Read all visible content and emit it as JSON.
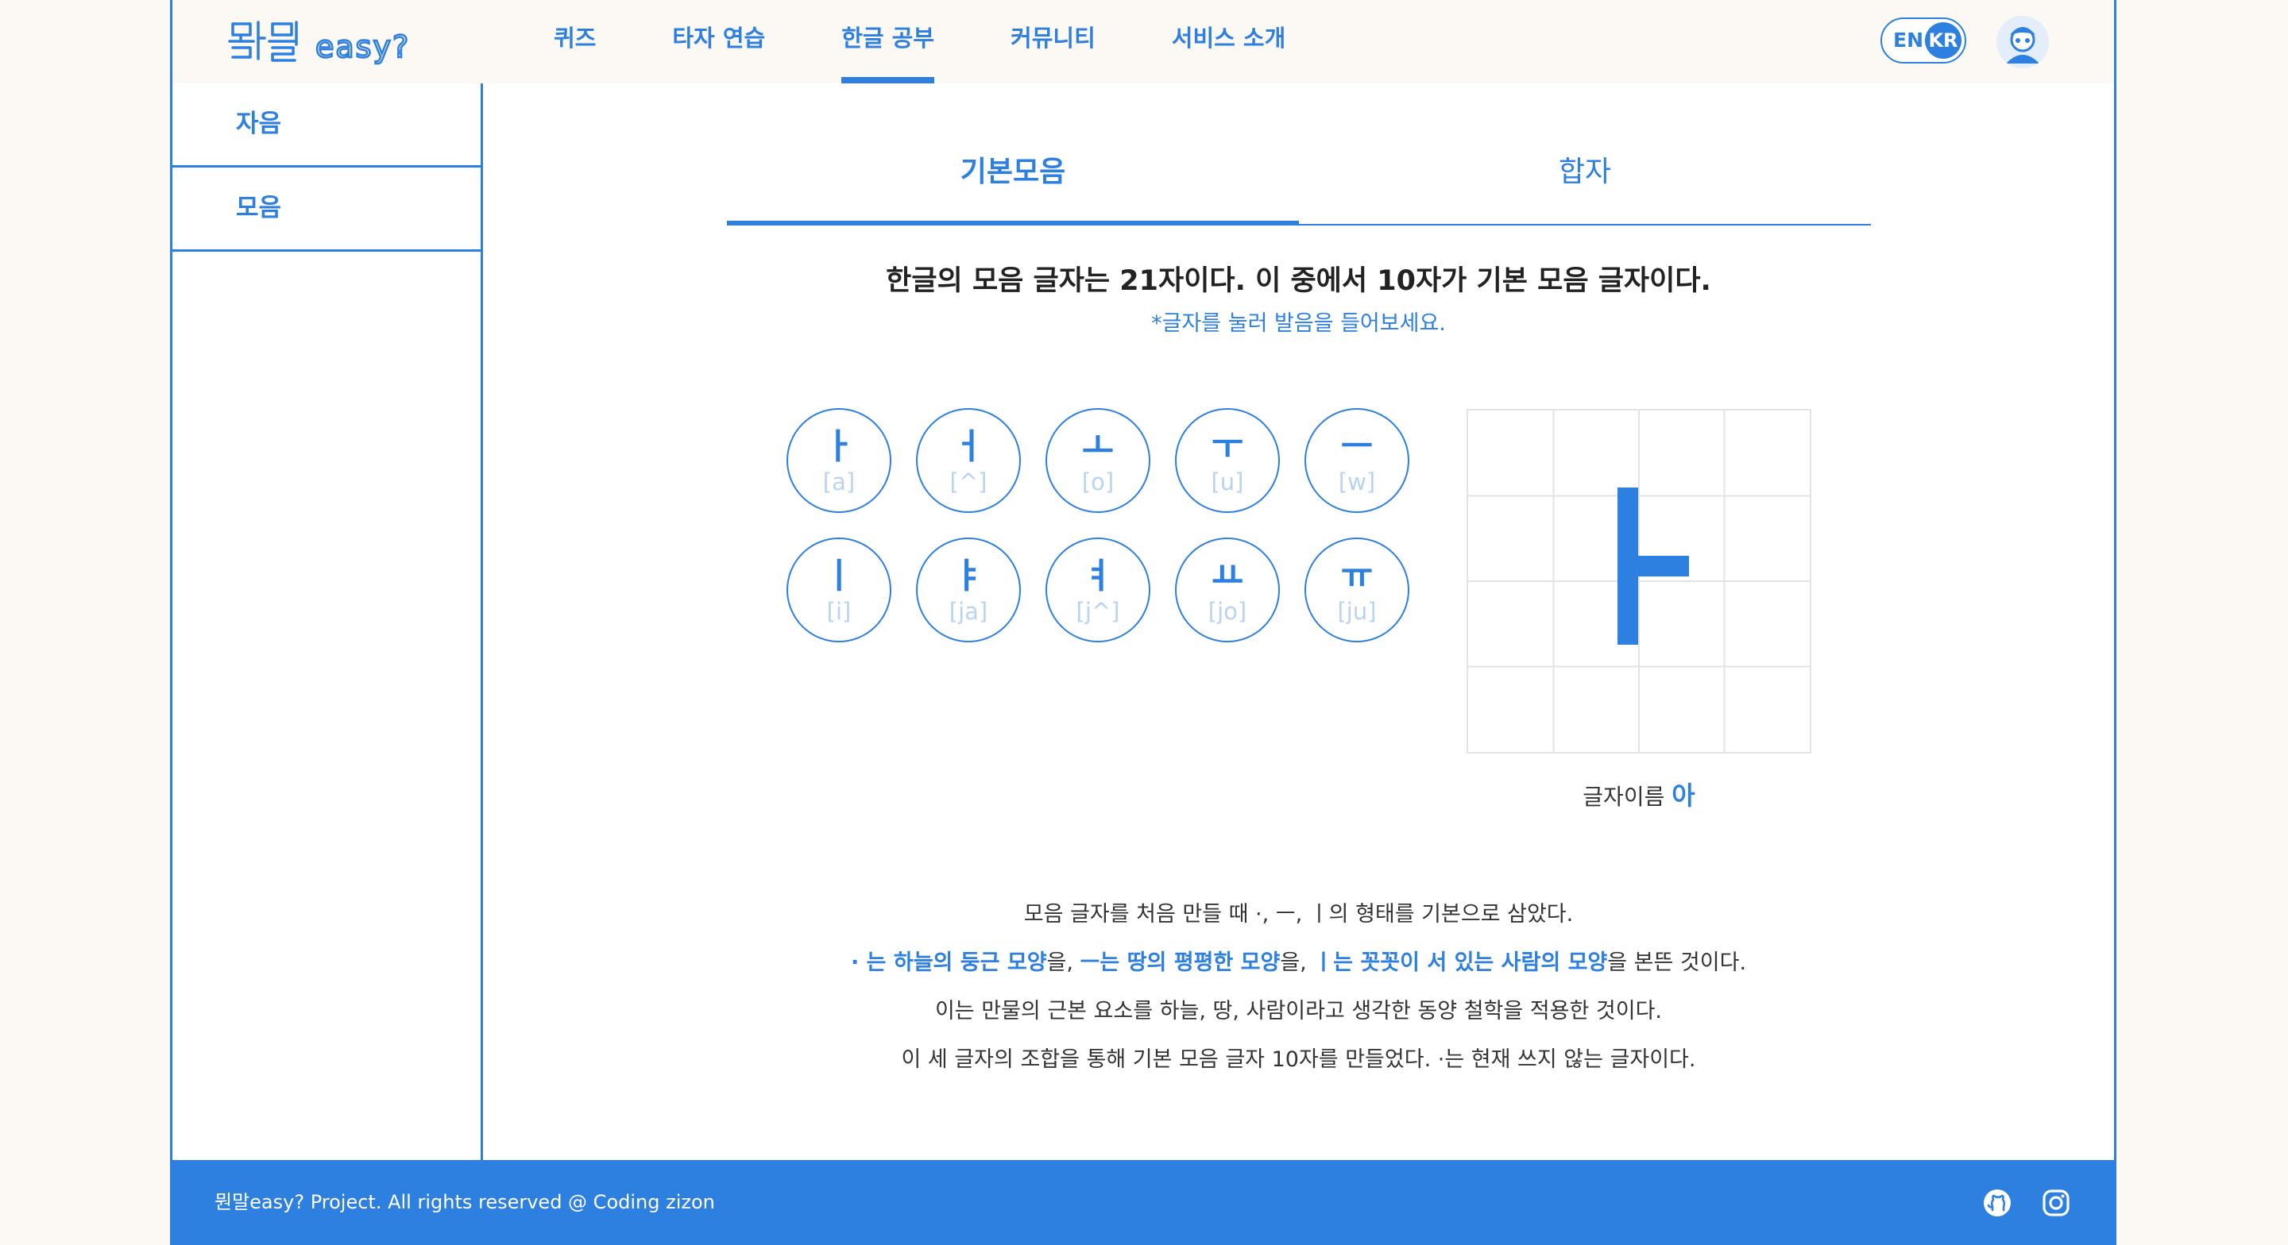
{
  "header": {
    "logo_text": "뭔말easy?",
    "nav": [
      "퀴즈",
      "타자 연습",
      "한글 공부",
      "커뮤니티",
      "서비스 소개"
    ],
    "lang": {
      "en": "EN",
      "kr": "KR"
    }
  },
  "sidebar": {
    "items": [
      "자음",
      "모음"
    ]
  },
  "tabs": [
    "기본모음",
    "합자"
  ],
  "main": {
    "heading": "한글의 모음 글자는 21자이다. 이 중에서 10자가 기본 모음 글자이다.",
    "subheading": "*글자를 눌러 발음을 들어보세요.",
    "vowels": [
      {
        "char": "ㅏ",
        "sound": "[a]"
      },
      {
        "char": "ㅓ",
        "sound": "[^]"
      },
      {
        "char": "ㅗ",
        "sound": "[o]"
      },
      {
        "char": "ㅜ",
        "sound": "[u]"
      },
      {
        "char": "ㅡ",
        "sound": "[w]"
      },
      {
        "char": "ㅣ",
        "sound": "[i]"
      },
      {
        "char": "ㅑ",
        "sound": "[ja]"
      },
      {
        "char": "ㅕ",
        "sound": "[j^]"
      },
      {
        "char": "ㅛ",
        "sound": "[jo]"
      },
      {
        "char": "ㅠ",
        "sound": "[ju]"
      }
    ],
    "letter_name_label": "글자이름",
    "letter_name_value": "아",
    "desc_line1": "모음 글자를 처음 만들 때 ·, ㅡ, ㅣ의 형태를 기본으로 삼았다.",
    "desc_line2": {
      "p1": "· 는 하늘의 둥근 모양",
      "s1": "을, ",
      "p2": "ㅡ는 땅의 평평한 모양",
      "s2": "을, ",
      "p3": "ㅣ는 꼿꼿이 서 있는 사람의 모양",
      "s3": "을 본뜬 것이다."
    },
    "desc_line3": "이는 만물의 근본 요소를 하늘, 땅, 사람이라고 생각한 동양 철학을 적용한 것이다.",
    "desc_line4": "이 세 글자의 조합을 통해 기본 모음 글자 10자를 만들었다. ·는 현재 쓰지 않는 글자이다."
  },
  "footer": {
    "copyright": "뭔말easy? Project. All rights reserved @ Coding zizon"
  },
  "colors": {
    "accent": "#2d7fe0",
    "background": "#fcf8f3",
    "muted_sound": "#b9d3f3"
  }
}
